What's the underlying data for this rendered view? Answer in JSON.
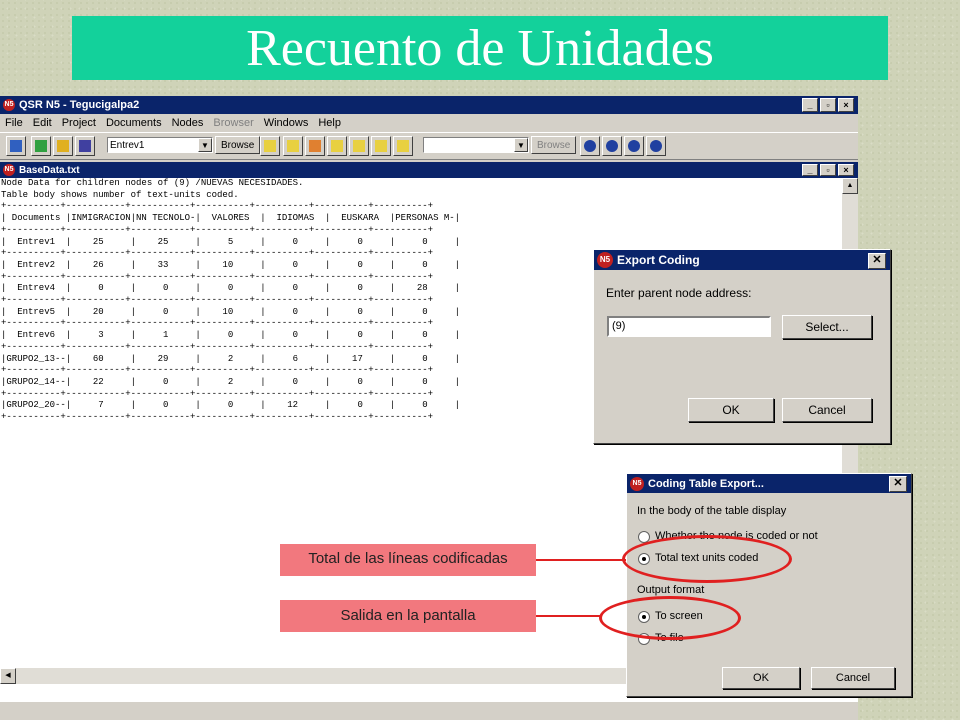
{
  "slide_title": "Recuento de Unidades",
  "app": {
    "title": "QSR N5 - Tegucigalpa2",
    "window_buttons": [
      "_",
      "▫",
      "×"
    ],
    "menu": [
      "File",
      "Edit",
      "Project",
      "Documents",
      "Nodes",
      "Browser",
      "Windows",
      "Help"
    ],
    "toolbar": {
      "document_combo": "Entrev1",
      "browse_label": "Browse",
      "node_combo": "",
      "browse2_label": "Browse"
    }
  },
  "doc_window": {
    "title": "BaseData.txt",
    "lines": [
      "Node Data for children nodes of (9) /NUEVAS NECESIDADES.",
      "Table body shows number of text-units coded.",
      "",
      "+----------+-----------+-----------+----------+----------+----------+----------+",
      "| Documents |INMIGRACION|NN TECNOLO-|  VALORES  |  IDIOMAS  |  EUSKARA  |PERSONAS M-|",
      "+----------+-----------+-----------+----------+----------+----------+----------+",
      "|  Entrev1  |    25     |    25     |     5     |     0     |     0     |     0     |",
      "+----------+-----------+-----------+----------+----------+----------+----------+",
      "|  Entrev2  |    26     |    33     |    10     |     0     |     0     |     0     |",
      "+----------+-----------+-----------+----------+----------+----------+----------+",
      "|  Entrev4  |     0     |     0     |     0     |     0     |     0     |    28     |",
      "+----------+-----------+-----------+----------+----------+----------+----------+",
      "|  Entrev5  |    20     |     0     |    10     |     0     |     0     |     0     |",
      "+----------+-----------+-----------+----------+----------+----------+----------+",
      "|  Entrev6  |     3     |     1     |     0     |     0     |     0     |     0     |",
      "+----------+-----------+-----------+----------+----------+----------+----------+",
      "|GRUPO2_13--|    60     |    29     |     2     |     6     |    17     |     0     |",
      "+----------+-----------+-----------+----------+----------+----------+----------+",
      "|GRUPO2_14--|    22     |     0     |     2     |     0     |     0     |     0     |",
      "+----------+-----------+-----------+----------+----------+----------+----------+",
      "|GRUPO2_20--|     7     |     0     |     0     |    12     |     0     |     0     |",
      "+----------+-----------+-----------+----------+----------+----------+----------+"
    ]
  },
  "export_coding": {
    "title": "Export Coding",
    "prompt": "Enter parent node address:",
    "value": "(9)",
    "select_label": "Select...",
    "ok_label": "OK",
    "cancel_label": "Cancel"
  },
  "coding_table_export": {
    "title": "Coding Table Export...",
    "body_heading": "In the body of the table display",
    "option_coded": "Whether the node is coded or not",
    "option_total": "Total text units coded",
    "output_heading": "Output format",
    "option_screen": "To screen",
    "option_file": "To file",
    "ok_label": "OK",
    "cancel_label": "Cancel"
  },
  "callouts": {
    "total": "Total de las líneas codificadas",
    "screen": "Salida en la pantalla"
  },
  "colors": {
    "title_band": "#13d19b",
    "titlebar": "#0a246a",
    "callout": "#f2787e",
    "highlight": "#e02020"
  }
}
